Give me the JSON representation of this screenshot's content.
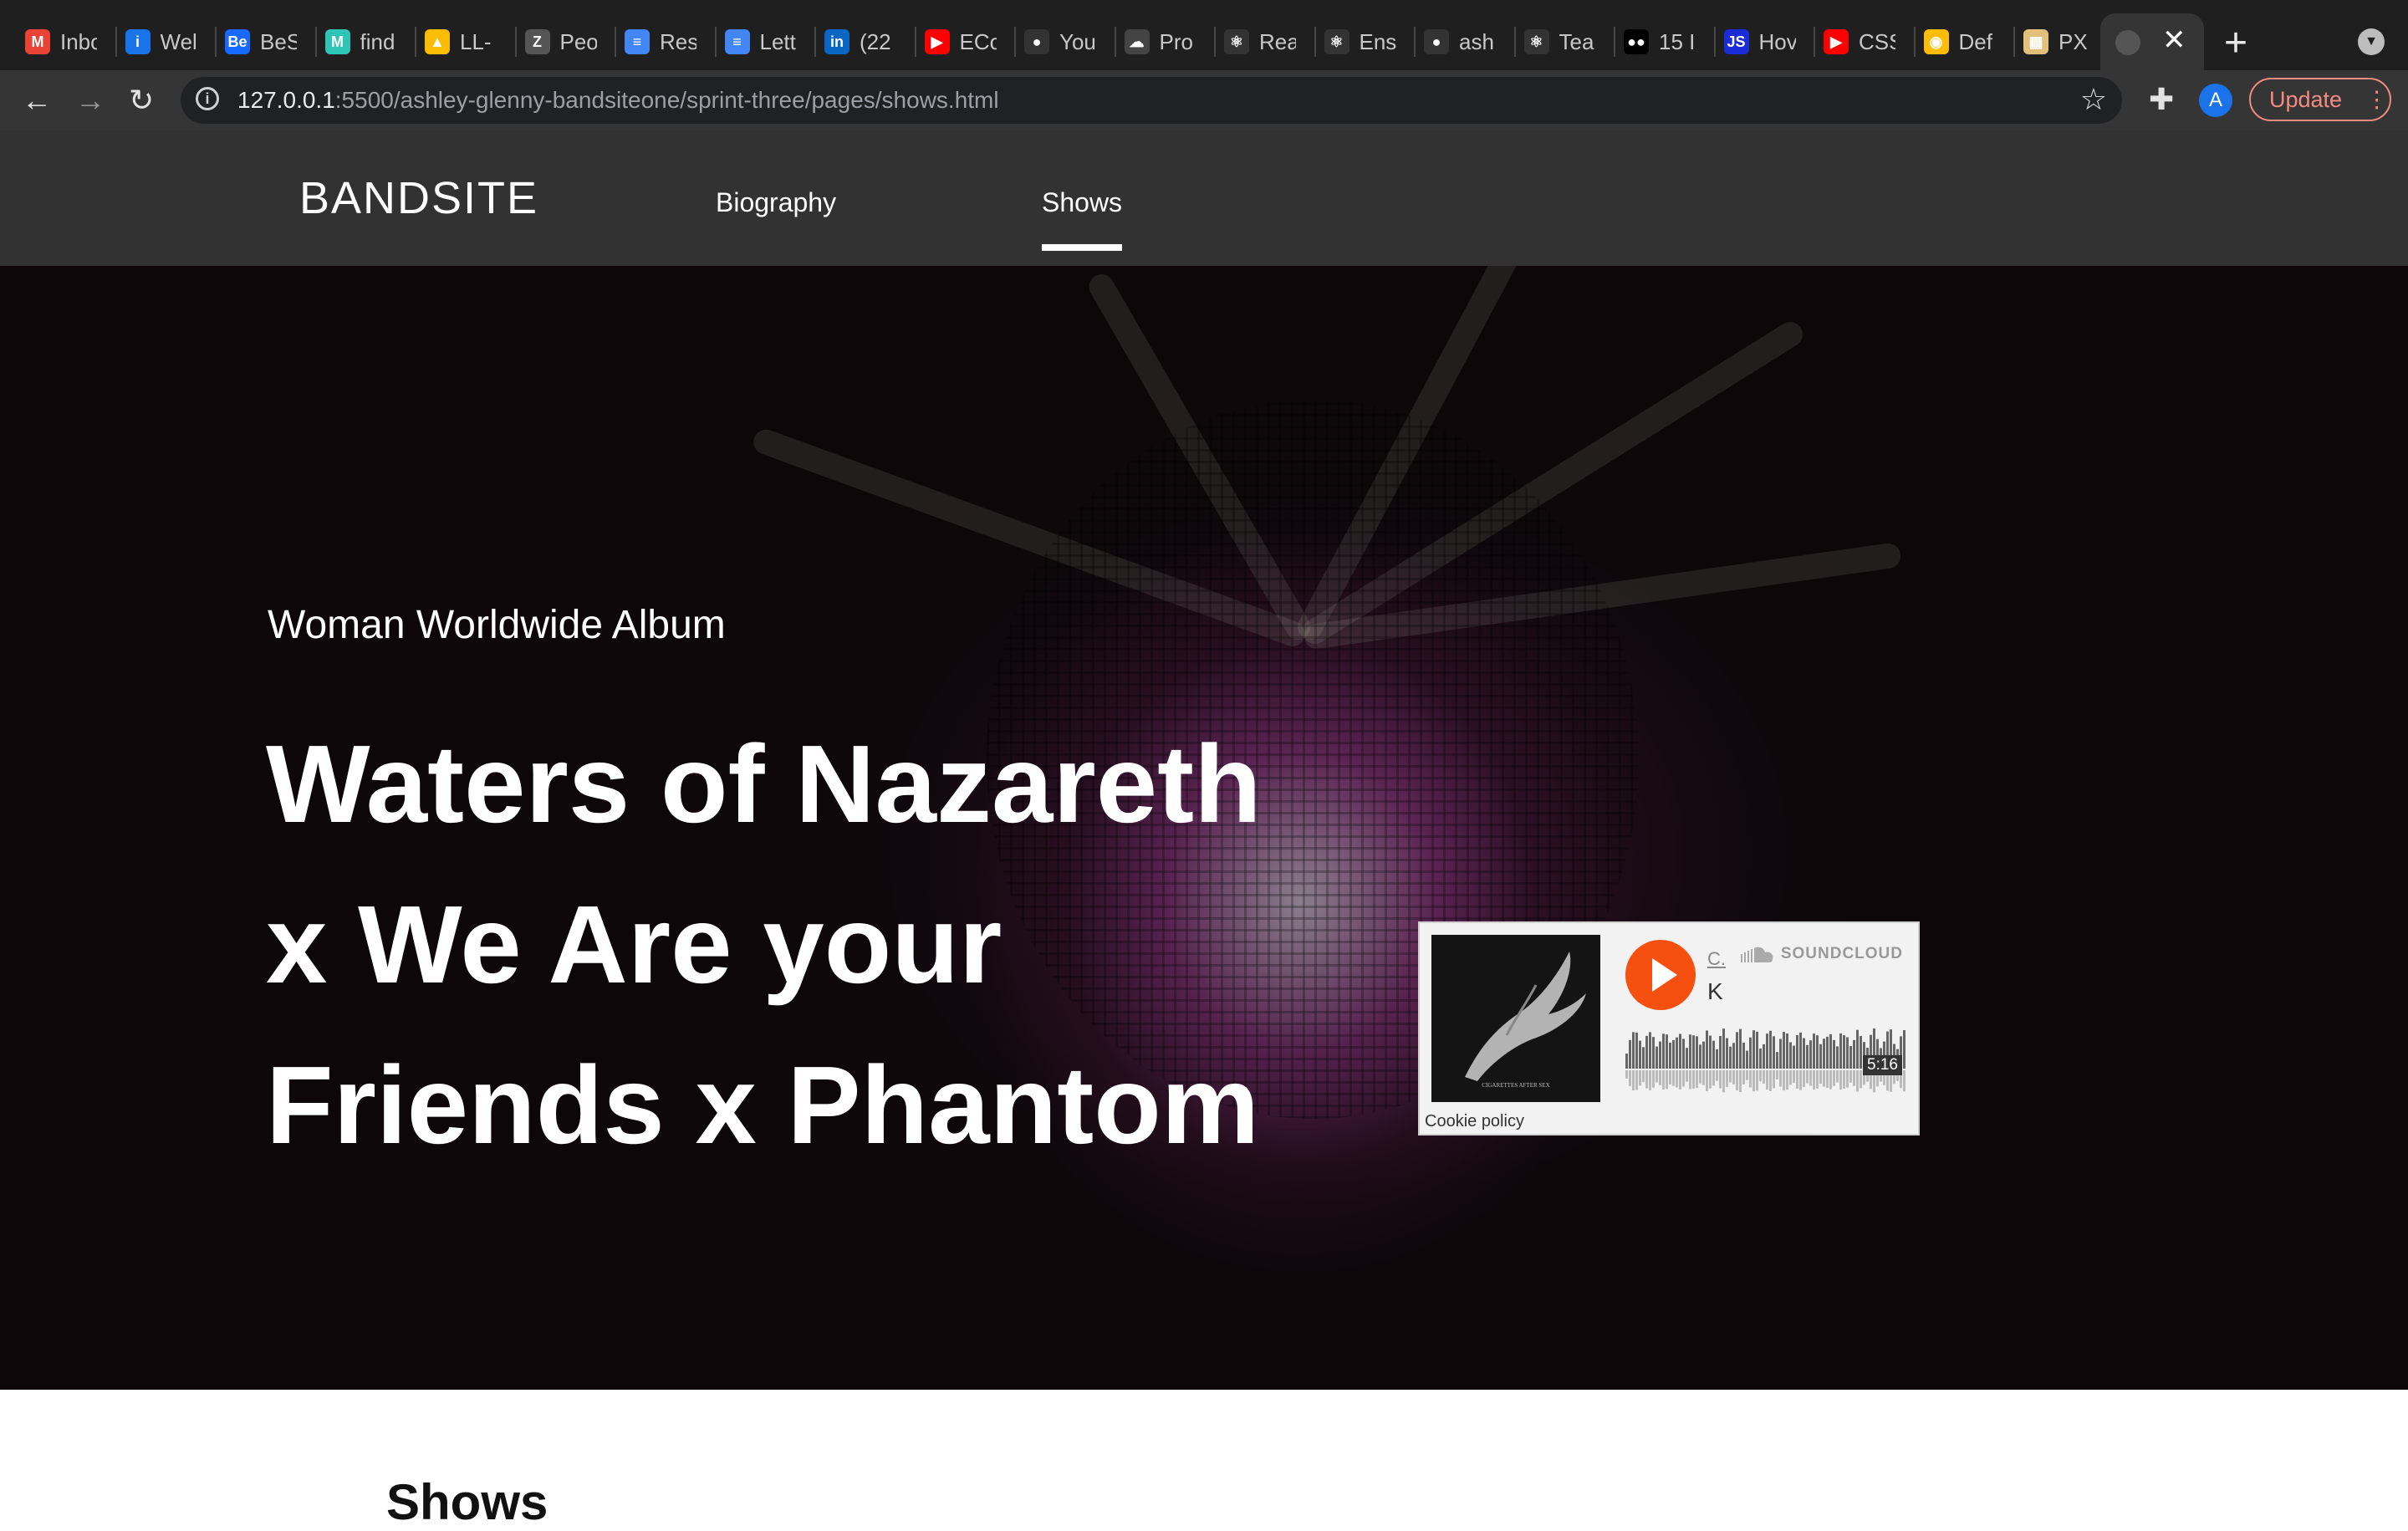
{
  "browser": {
    "tabs": [
      {
        "label": "Inbo",
        "icon": "gmail-icon",
        "color": "#ea4335",
        "glyph": "M"
      },
      {
        "label": "Wel",
        "icon": "info-icon",
        "color": "#1a73e8",
        "glyph": "i"
      },
      {
        "label": "BeS",
        "icon": "behance-icon",
        "color": "#1769ff",
        "glyph": "Be"
      },
      {
        "label": "find",
        "icon": "miro-icon",
        "color": "#2ec4b6",
        "glyph": "M"
      },
      {
        "label": "LL-",
        "icon": "google-drive-icon",
        "color": "#fbbc04",
        "glyph": "▲"
      },
      {
        "label": "Peo",
        "icon": "zendesk-icon",
        "color": "#555555",
        "glyph": "Z"
      },
      {
        "label": "Res",
        "icon": "google-docs-icon",
        "color": "#4285f4",
        "glyph": "≡"
      },
      {
        "label": "Lett",
        "icon": "google-docs-icon",
        "color": "#4285f4",
        "glyph": "≡"
      },
      {
        "label": "(22",
        "icon": "linkedin-icon",
        "color": "#0a66c2",
        "glyph": "in"
      },
      {
        "label": "ECo",
        "icon": "youtube-icon",
        "color": "#ff0000",
        "glyph": "▶"
      },
      {
        "label": "You",
        "icon": "github-icon",
        "color": "#333333",
        "glyph": "●"
      },
      {
        "label": "Pro",
        "icon": "cloud-icon",
        "color": "#444444",
        "glyph": "☁"
      },
      {
        "label": "Rea",
        "icon": "react-icon",
        "color": "#333333",
        "glyph": "⚛"
      },
      {
        "label": "Ens",
        "icon": "react-icon",
        "color": "#333333",
        "glyph": "⚛"
      },
      {
        "label": "ash",
        "icon": "github-icon",
        "color": "#333333",
        "glyph": "●"
      },
      {
        "label": "Tea",
        "icon": "react-icon",
        "color": "#333333",
        "glyph": "⚛"
      },
      {
        "label": "15 I",
        "icon": "medium-icon",
        "color": "#000000",
        "glyph": "●●"
      },
      {
        "label": "Hov",
        "icon": "js-icon",
        "color": "#1a2bd8",
        "glyph": "JS"
      },
      {
        "label": "CSS",
        "icon": "youtube-icon",
        "color": "#ff0000",
        "glyph": "▶"
      },
      {
        "label": "Def",
        "icon": "chrome-icon",
        "color": "#fbbc04",
        "glyph": "◉"
      },
      {
        "label": "PX",
        "icon": "calculator-icon",
        "color": "#e0c07a",
        "glyph": "▦"
      }
    ],
    "active_tab": {
      "close": "✕"
    },
    "new_tab": "+",
    "url_host": "127.0.0.1",
    "url_rest": ":5500/ashley-glenny-bandsiteone/sprint-three/pages/shows.html",
    "update_label": "Update",
    "avatar_letter": "A"
  },
  "site": {
    "logo": "BANDSITE",
    "nav": [
      {
        "label": "Biography"
      },
      {
        "label": "Shows"
      }
    ]
  },
  "hero": {
    "kicker": "Woman Worldwide Album",
    "title_lines": [
      "Waters of Nazareth",
      "x We Are your",
      "Friends x Phantom"
    ]
  },
  "soundcloud": {
    "artist": "C.",
    "track": "K",
    "brand": "SOUNDCLOUD",
    "duration": "5:16",
    "cookie": "Cookie policy",
    "art_caption": "CIGARETTES AFTER SEX",
    "accent": "#f5500f"
  },
  "shows": {
    "heading": "Shows"
  }
}
